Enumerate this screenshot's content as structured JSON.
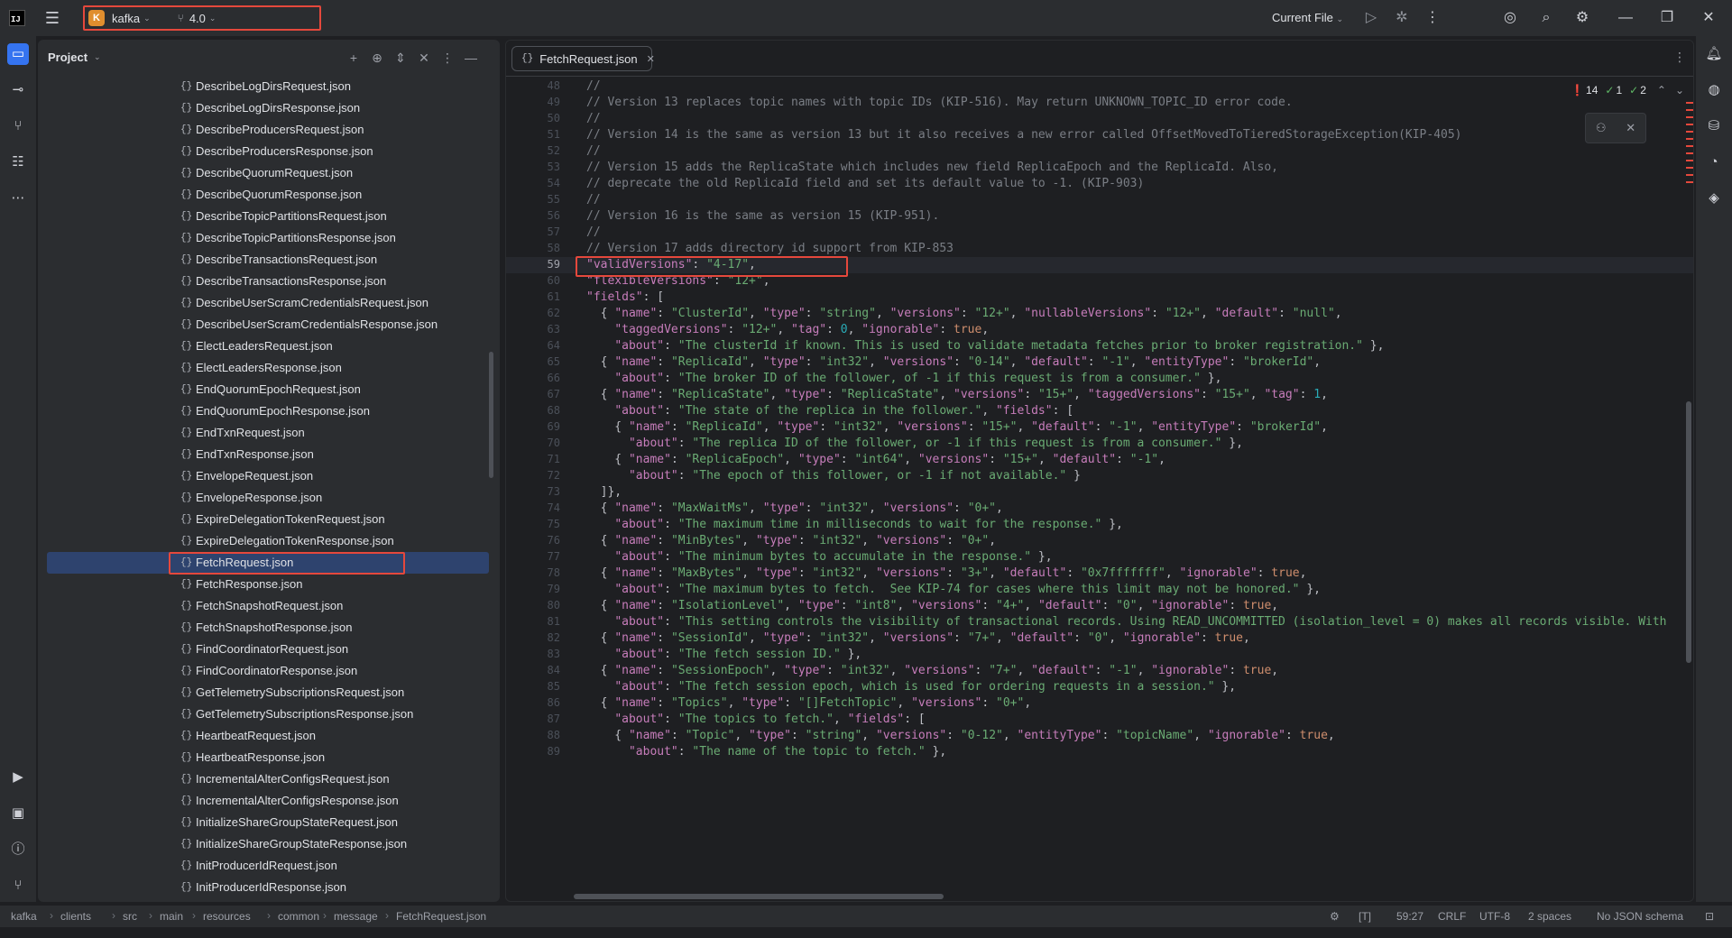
{
  "titlebar": {
    "app_logo": "IJ",
    "project_badge": "K",
    "project_name": "kafka",
    "branch": "4.0",
    "run_config": "Current File",
    "icons": [
      "run-icon",
      "debug-icon",
      "more-icon",
      "ai-assistant-icon",
      "search-icon",
      "settings-icon",
      "minimize-icon",
      "restore-icon",
      "close-icon"
    ]
  },
  "project_panel": {
    "title": "Project",
    "files": [
      "DescribeLogDirsRequest.json",
      "DescribeLogDirsResponse.json",
      "DescribeProducersRequest.json",
      "DescribeProducersResponse.json",
      "DescribeQuorumRequest.json",
      "DescribeQuorumResponse.json",
      "DescribeTopicPartitionsRequest.json",
      "DescribeTopicPartitionsResponse.json",
      "DescribeTransactionsRequest.json",
      "DescribeTransactionsResponse.json",
      "DescribeUserScramCredentialsRequest.json",
      "DescribeUserScramCredentialsResponse.json",
      "ElectLeadersRequest.json",
      "ElectLeadersResponse.json",
      "EndQuorumEpochRequest.json",
      "EndQuorumEpochResponse.json",
      "EndTxnRequest.json",
      "EndTxnResponse.json",
      "EnvelopeRequest.json",
      "EnvelopeResponse.json",
      "ExpireDelegationTokenRequest.json",
      "ExpireDelegationTokenResponse.json",
      "FetchRequest.json",
      "FetchResponse.json",
      "FetchSnapshotRequest.json",
      "FetchSnapshotResponse.json",
      "FindCoordinatorRequest.json",
      "FindCoordinatorResponse.json",
      "GetTelemetrySubscriptionsRequest.json",
      "GetTelemetrySubscriptionsResponse.json",
      "HeartbeatRequest.json",
      "HeartbeatResponse.json",
      "IncrementalAlterConfigsRequest.json",
      "IncrementalAlterConfigsResponse.json",
      "InitializeShareGroupStateRequest.json",
      "InitializeShareGroupStateResponse.json",
      "InitProducerIdRequest.json",
      "InitProducerIdResponse.json"
    ],
    "selected_index": 22
  },
  "editor": {
    "tab_label": "FetchRequest.json",
    "inspections": {
      "errors": "14",
      "warnings": "1",
      "weak": "2"
    },
    "current_line": "59",
    "lines": [
      {
        "n": "48",
        "code": "//"
      },
      {
        "n": "49",
        "code": "// Version 13 replaces topic names with topic IDs (KIP-516). May return UNKNOWN_TOPIC_ID error code."
      },
      {
        "n": "50",
        "code": "//"
      },
      {
        "n": "51",
        "code": "// Version 14 is the same as version 13 but it also receives a new error called OffsetMovedToTieredStorageException(KIP-405)"
      },
      {
        "n": "52",
        "code": "//"
      },
      {
        "n": "53",
        "code": "// Version 15 adds the ReplicaState which includes new field ReplicaEpoch and the ReplicaId. Also,"
      },
      {
        "n": "54",
        "code": "// deprecate the old ReplicaId field and set its default value to -1. (KIP-903)"
      },
      {
        "n": "55",
        "code": "//"
      },
      {
        "n": "56",
        "code": "// Version 16 is the same as version 15 (KIP-951)."
      },
      {
        "n": "57",
        "code": "//"
      },
      {
        "n": "58",
        "code": "// Version 17 adds directory id support from KIP-853"
      },
      {
        "n": "59",
        "code": "\"validVersions\": \"4-17\","
      },
      {
        "n": "60",
        "code": "\"flexibleVersions\": \"12+\","
      },
      {
        "n": "61",
        "code": "\"fields\": ["
      },
      {
        "n": "62",
        "code": "  { \"name\": \"ClusterId\", \"type\": \"string\", \"versions\": \"12+\", \"nullableVersions\": \"12+\", \"default\": \"null\","
      },
      {
        "n": "63",
        "code": "    \"taggedVersions\": \"12+\", \"tag\": 0, \"ignorable\": true,"
      },
      {
        "n": "64",
        "code": "    \"about\": \"The clusterId if known. This is used to validate metadata fetches prior to broker registration.\" },"
      },
      {
        "n": "65",
        "code": "  { \"name\": \"ReplicaId\", \"type\": \"int32\", \"versions\": \"0-14\", \"default\": \"-1\", \"entityType\": \"brokerId\","
      },
      {
        "n": "66",
        "code": "    \"about\": \"The broker ID of the follower, of -1 if this request is from a consumer.\" },"
      },
      {
        "n": "67",
        "code": "  { \"name\": \"ReplicaState\", \"type\": \"ReplicaState\", \"versions\": \"15+\", \"taggedVersions\": \"15+\", \"tag\": 1,"
      },
      {
        "n": "68",
        "code": "    \"about\": \"The state of the replica in the follower.\", \"fields\": ["
      },
      {
        "n": "69",
        "code": "    { \"name\": \"ReplicaId\", \"type\": \"int32\", \"versions\": \"15+\", \"default\": \"-1\", \"entityType\": \"brokerId\","
      },
      {
        "n": "70",
        "code": "      \"about\": \"The replica ID of the follower, or -1 if this request is from a consumer.\" },"
      },
      {
        "n": "71",
        "code": "    { \"name\": \"ReplicaEpoch\", \"type\": \"int64\", \"versions\": \"15+\", \"default\": \"-1\","
      },
      {
        "n": "72",
        "code": "      \"about\": \"The epoch of this follower, or -1 if not available.\" }"
      },
      {
        "n": "73",
        "code": "  ]},"
      },
      {
        "n": "74",
        "code": "  { \"name\": \"MaxWaitMs\", \"type\": \"int32\", \"versions\": \"0+\","
      },
      {
        "n": "75",
        "code": "    \"about\": \"The maximum time in milliseconds to wait for the response.\" },"
      },
      {
        "n": "76",
        "code": "  { \"name\": \"MinBytes\", \"type\": \"int32\", \"versions\": \"0+\","
      },
      {
        "n": "77",
        "code": "    \"about\": \"The minimum bytes to accumulate in the response.\" },"
      },
      {
        "n": "78",
        "code": "  { \"name\": \"MaxBytes\", \"type\": \"int32\", \"versions\": \"3+\", \"default\": \"0x7fffffff\", \"ignorable\": true,"
      },
      {
        "n": "79",
        "code": "    \"about\": \"The maximum bytes to fetch.  See KIP-74 for cases where this limit may not be honored.\" },"
      },
      {
        "n": "80",
        "code": "  { \"name\": \"IsolationLevel\", \"type\": \"int8\", \"versions\": \"4+\", \"default\": \"0\", \"ignorable\": true,"
      },
      {
        "n": "81",
        "code": "    \"about\": \"This setting controls the visibility of transactional records. Using READ_UNCOMMITTED (isolation_level = 0) makes all records visible. With"
      },
      {
        "n": "82",
        "code": "  { \"name\": \"SessionId\", \"type\": \"int32\", \"versions\": \"7+\", \"default\": \"0\", \"ignorable\": true,"
      },
      {
        "n": "83",
        "code": "    \"about\": \"The fetch session ID.\" },"
      },
      {
        "n": "84",
        "code": "  { \"name\": \"SessionEpoch\", \"type\": \"int32\", \"versions\": \"7+\", \"default\": \"-1\", \"ignorable\": true,"
      },
      {
        "n": "85",
        "code": "    \"about\": \"The fetch session epoch, which is used for ordering requests in a session.\" },"
      },
      {
        "n": "86",
        "code": "  { \"name\": \"Topics\", \"type\": \"[]FetchTopic\", \"versions\": \"0+\","
      },
      {
        "n": "87",
        "code": "    \"about\": \"The topics to fetch.\", \"fields\": ["
      },
      {
        "n": "88",
        "code": "    { \"name\": \"Topic\", \"type\": \"string\", \"versions\": \"0-12\", \"entityType\": \"topicName\", \"ignorable\": true,"
      },
      {
        "n": "89",
        "code": "      \"about\": \"The name of the topic to fetch.\" },"
      }
    ]
  },
  "statusbar": {
    "breadcrumbs": [
      "kafka",
      "clients",
      "src",
      "main",
      "resources",
      "common",
      "message",
      "FetchRequest.json"
    ],
    "position": "59:27",
    "line_sep": "CRLF",
    "encoding": "UTF-8",
    "indent": "2 spaces",
    "schema": "No JSON schema"
  },
  "colors": {
    "accent": "#3574f0",
    "highlight_box": "#e5483c",
    "selection": "#2e436e",
    "json_key": "#c77dbb",
    "json_string": "#6aab73",
    "json_number": "#2aacb8",
    "keyword": "#cf8e6d",
    "comment": "#7a7e85"
  }
}
